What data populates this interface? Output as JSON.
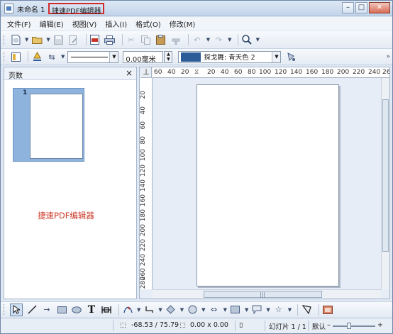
{
  "window": {
    "title": "未命名 1",
    "subtitle": "捷速PDF编辑器",
    "controls": {
      "minimize": "–",
      "maximize": "□",
      "close": "✕"
    }
  },
  "menu": {
    "items": [
      "文件(F)",
      "编辑(E)",
      "视图(V)",
      "插入(I)",
      "格式(O)",
      "修改(M)"
    ]
  },
  "line_toolbar": {
    "line_width": "0.00毫米",
    "area_color_label": "探戈舞: 青天色 2",
    "area_color": "#2c5c97",
    "expand": "»"
  },
  "pages_pane": {
    "title": "页数",
    "close": "×",
    "thumbnails": [
      {
        "number": "1"
      }
    ]
  },
  "watermark": "捷速PDF编辑器",
  "ruler": {
    "horizontal_ticks": [
      "60",
      "40",
      "20",
      "20",
      "40",
      "60",
      "80",
      "100",
      "120",
      "140",
      "160",
      "180",
      "200",
      "220",
      "240",
      "26"
    ],
    "vertical_ticks": [
      "20",
      "40",
      "60",
      "80",
      "100",
      "120",
      "140",
      "160",
      "180",
      "200",
      "220",
      "240",
      "260",
      "280"
    ]
  },
  "statusbar": {
    "position": "-68.53 / 75.79",
    "size": "0.00 x 0.00",
    "slide": "幻灯片 1 / 1",
    "layout": "默认"
  },
  "icons": {
    "toolbar1": [
      "new-document-icon",
      "open-folder-icon",
      "save-icon",
      "edit-file-icon",
      "export-pdf-icon",
      "print-icon",
      "cut-icon",
      "copy-icon",
      "paste-icon",
      "clone-format-icon",
      "undo-icon",
      "redo-icon",
      "zoom-icon"
    ],
    "toolbar2": [
      "style-icon",
      "fill-icon",
      "arrow-style-icon",
      "area-fill-icon"
    ],
    "drawbar": [
      "select-icon",
      "line-icon",
      "arrow-line-icon",
      "rectangle-icon",
      "ellipse-icon",
      "text-icon",
      "fit-text-icon",
      "curve-icon",
      "connector-icon",
      "basic-shapes-icon",
      "symbol-shapes-icon",
      "block-arrows-icon",
      "flowchart-icon",
      "callouts-icon",
      "stars-icon",
      "glue-points-icon",
      "image-icon"
    ]
  }
}
